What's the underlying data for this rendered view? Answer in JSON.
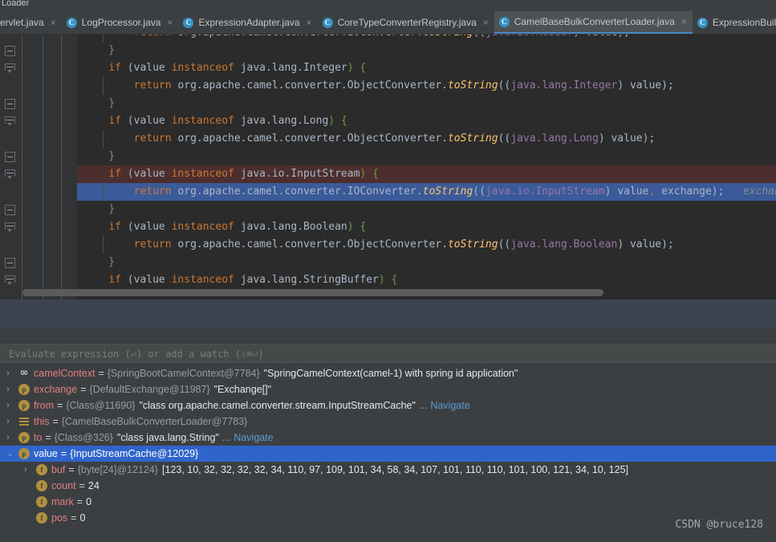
{
  "window": {
    "title_fragment": "Loader"
  },
  "tabs": [
    {
      "label": "ervlet.java",
      "icon": "java-class-icon",
      "active": false,
      "cut": true,
      "close": "×"
    },
    {
      "label": "LogProcessor.java",
      "icon": "java-class-icon",
      "active": false,
      "cut": false,
      "close": "×"
    },
    {
      "label": "ExpressionAdapter.java",
      "icon": "java-class-icon",
      "active": false,
      "cut": false,
      "close": "×"
    },
    {
      "label": "CoreTypeConverterRegistry.java",
      "icon": "java-class-icon",
      "active": false,
      "cut": false,
      "close": "×"
    },
    {
      "label": "CamelBaseBulkConverterLoader.java",
      "icon": "java-class-icon",
      "active": true,
      "cut": false,
      "close": "×"
    },
    {
      "label": "ExpressionBuild",
      "icon": "java-class-icon",
      "active": false,
      "cut": false,
      "close": ""
    }
  ],
  "editor": {
    "lines": [
      {
        "state": "partial",
        "indent_guide": true,
        "tokens": [
          {
            "t": "        ",
            "c": "pun"
          },
          {
            "t": "return",
            "c": "kw"
          },
          {
            "t": " org.apache.camel.converter.IOConverter.",
            "c": "typ"
          },
          {
            "t": "toString",
            "c": "mth"
          },
          {
            "t": "((",
            "c": "pun"
          },
          {
            "t": "java.io.Reader",
            "c": "cast"
          },
          {
            "t": ") value);",
            "c": "pun"
          }
        ]
      },
      {
        "state": "normal",
        "fold": "collapse",
        "indent_guide": false,
        "tokens": [
          {
            "t": "    }",
            "c": "br1"
          }
        ]
      },
      {
        "state": "normal",
        "fold": "tri",
        "indent_guide": false,
        "tokens": [
          {
            "t": "    ",
            "c": "pun"
          },
          {
            "t": "if",
            "c": "kw"
          },
          {
            "t": " (value ",
            "c": "pun"
          },
          {
            "t": "instanceof",
            "c": "kw"
          },
          {
            "t": " java.lang.Integer",
            "c": "typ"
          },
          {
            "t": ") ",
            "c": "par"
          },
          {
            "t": "{",
            "c": "par"
          }
        ]
      },
      {
        "state": "normal",
        "indent_guide": true,
        "tokens": [
          {
            "t": "        ",
            "c": "pun"
          },
          {
            "t": "return",
            "c": "kw"
          },
          {
            "t": " org.apache.camel.converter.ObjectConverter.",
            "c": "typ"
          },
          {
            "t": "toString",
            "c": "mth"
          },
          {
            "t": "((",
            "c": "pun"
          },
          {
            "t": "java.lang.Integer",
            "c": "cast"
          },
          {
            "t": ") value);",
            "c": "pun"
          }
        ]
      },
      {
        "state": "normal",
        "fold": "collapse",
        "indent_guide": false,
        "tokens": [
          {
            "t": "    }",
            "c": "br1"
          }
        ]
      },
      {
        "state": "normal",
        "fold": "tri",
        "indent_guide": false,
        "tokens": [
          {
            "t": "    ",
            "c": "pun"
          },
          {
            "t": "if",
            "c": "kw"
          },
          {
            "t": " (value ",
            "c": "pun"
          },
          {
            "t": "instanceof",
            "c": "kw"
          },
          {
            "t": " java.lang.Long",
            "c": "typ"
          },
          {
            "t": ") ",
            "c": "par"
          },
          {
            "t": "{",
            "c": "par"
          }
        ]
      },
      {
        "state": "normal",
        "indent_guide": true,
        "tokens": [
          {
            "t": "        ",
            "c": "pun"
          },
          {
            "t": "return",
            "c": "kw"
          },
          {
            "t": " org.apache.camel.converter.ObjectConverter.",
            "c": "typ"
          },
          {
            "t": "toString",
            "c": "mth"
          },
          {
            "t": "((",
            "c": "pun"
          },
          {
            "t": "java.lang.Long",
            "c": "cast"
          },
          {
            "t": ") value);",
            "c": "pun"
          }
        ]
      },
      {
        "state": "normal",
        "fold": "collapse",
        "indent_guide": false,
        "tokens": [
          {
            "t": "    }",
            "c": "br1"
          }
        ]
      },
      {
        "state": "breakpoint",
        "fold": "tri",
        "indent_guide": false,
        "tokens": [
          {
            "t": "    ",
            "c": "pun"
          },
          {
            "t": "if",
            "c": "kw"
          },
          {
            "t": " (value ",
            "c": "pun"
          },
          {
            "t": "instanceof",
            "c": "kw"
          },
          {
            "t": " java.io.InputStream",
            "c": "typ"
          },
          {
            "t": ") ",
            "c": "par"
          },
          {
            "t": "{",
            "c": "par"
          }
        ]
      },
      {
        "state": "executing",
        "indent_guide": true,
        "tokens": [
          {
            "t": "        ",
            "c": "pun"
          },
          {
            "t": "return",
            "c": "kw"
          },
          {
            "t": " org.apache.camel.converter.IOConverter.",
            "c": "typ"
          },
          {
            "t": "toString",
            "c": "mth"
          },
          {
            "t": "((",
            "c": "pun"
          },
          {
            "t": "java.io.InputStream",
            "c": "cast"
          },
          {
            "t": ") value",
            "c": "pun"
          },
          {
            "t": ",",
            "c": "kw"
          },
          {
            "t": " exchange);",
            "c": "pun"
          },
          {
            "t": "   exchange:",
            "c": "hint"
          }
        ]
      },
      {
        "state": "normal",
        "fold": "collapse",
        "indent_guide": false,
        "tokens": [
          {
            "t": "    }",
            "c": "br1"
          }
        ]
      },
      {
        "state": "normal",
        "fold": "tri",
        "indent_guide": false,
        "tokens": [
          {
            "t": "    ",
            "c": "pun"
          },
          {
            "t": "if",
            "c": "kw"
          },
          {
            "t": " (value ",
            "c": "pun"
          },
          {
            "t": "instanceof",
            "c": "kw"
          },
          {
            "t": " java.lang.Boolean",
            "c": "typ"
          },
          {
            "t": ") ",
            "c": "par"
          },
          {
            "t": "{",
            "c": "par"
          }
        ]
      },
      {
        "state": "normal",
        "indent_guide": true,
        "tokens": [
          {
            "t": "        ",
            "c": "pun"
          },
          {
            "t": "return",
            "c": "kw"
          },
          {
            "t": " org.apache.camel.converter.ObjectConverter.",
            "c": "typ"
          },
          {
            "t": "toString",
            "c": "mth"
          },
          {
            "t": "((",
            "c": "pun"
          },
          {
            "t": "java.lang.Boolean",
            "c": "cast"
          },
          {
            "t": ") value);",
            "c": "pun"
          }
        ]
      },
      {
        "state": "normal",
        "fold": "collapse",
        "indent_guide": false,
        "tokens": [
          {
            "t": "    }",
            "c": "br1"
          }
        ]
      },
      {
        "state": "normal",
        "fold": "tri",
        "indent_guide": false,
        "tokens": [
          {
            "t": "    ",
            "c": "pun"
          },
          {
            "t": "if",
            "c": "kw"
          },
          {
            "t": " (value ",
            "c": "pun"
          },
          {
            "t": "instanceof",
            "c": "kw"
          },
          {
            "t": " java.lang.StringBuffer",
            "c": "typ"
          },
          {
            "t": ") ",
            "c": "par"
          },
          {
            "t": "{",
            "c": "par"
          }
        ]
      }
    ]
  },
  "debugger": {
    "evaluate_placeholder": "Evaluate expression (⏎) or add a watch (⇧⌘⏎)",
    "variables": [
      {
        "twisty": "›",
        "icon": "watch-icon",
        "icon_glyph": "∞",
        "name": "camelContext",
        "eq": "=",
        "type": "{SpringBootCamelContext@7784}",
        "value": "\"SpringCamelContext(camel-1) with spring id application\"",
        "navigate": "",
        "ellipsis": "",
        "selected": false,
        "indent": 0
      },
      {
        "twisty": "›",
        "icon": "parameter-icon",
        "icon_glyph": "p",
        "name": "exchange",
        "eq": "=",
        "type": "{DefaultExchange@11987}",
        "value": "\"Exchange[]\"",
        "navigate": "",
        "ellipsis": "",
        "selected": false,
        "indent": 0
      },
      {
        "twisty": "›",
        "icon": "parameter-icon",
        "icon_glyph": "p",
        "name": "from",
        "eq": "=",
        "type": "{Class@11690}",
        "value": "\"class org.apache.camel.converter.stream.InputStreamCache\"",
        "navigate": "Navigate",
        "ellipsis": "...",
        "selected": false,
        "indent": 0
      },
      {
        "twisty": "›",
        "icon": "this-icon",
        "icon_glyph": "",
        "name": "this",
        "eq": "=",
        "type": "{CamelBaseBulkConverterLoader@7783}",
        "value": "",
        "navigate": "",
        "ellipsis": "",
        "selected": false,
        "indent": 0
      },
      {
        "twisty": "›",
        "icon": "parameter-icon",
        "icon_glyph": "p",
        "name": "to",
        "eq": "=",
        "type": "{Class@326}",
        "value": "\"class java.lang.String\"",
        "navigate": "Navigate",
        "ellipsis": "...",
        "selected": false,
        "indent": 0
      },
      {
        "twisty": "⌄",
        "icon": "parameter-icon",
        "icon_glyph": "p",
        "name": "value",
        "eq": "=",
        "type": "{InputStreamCache@12029}",
        "value": "",
        "navigate": "",
        "ellipsis": "",
        "selected": true,
        "indent": 0
      },
      {
        "twisty": "›",
        "icon": "field-icon",
        "icon_glyph": "f",
        "name": "buf",
        "eq": "=",
        "type": "{byte[24]@12124}",
        "value": "[123, 10, 32, 32, 32, 32, 34, 110, 97, 109, 101, 34, 58, 34, 107, 101, 110, 110, 101, 100, 121, 34, 10, 125]",
        "navigate": "",
        "ellipsis": "",
        "selected": false,
        "indent": 1
      },
      {
        "twisty": "",
        "icon": "field-icon",
        "icon_glyph": "f",
        "name": "count",
        "eq": "=",
        "type": "",
        "value": "24",
        "navigate": "",
        "ellipsis": "",
        "selected": false,
        "indent": 1
      },
      {
        "twisty": "",
        "icon": "field-icon",
        "icon_glyph": "f",
        "name": "mark",
        "eq": "=",
        "type": "",
        "value": "0",
        "navigate": "",
        "ellipsis": "",
        "selected": false,
        "indent": 1
      },
      {
        "twisty": "",
        "icon": "field-icon",
        "icon_glyph": "f",
        "name": "pos",
        "eq": "=",
        "type": "",
        "value": "0",
        "navigate": "",
        "ellipsis": "",
        "selected": false,
        "indent": 1
      }
    ]
  },
  "watermark": "CSDN @bruce128",
  "colors": {
    "editor_bg": "#2b2b2b",
    "panel_bg": "#3c3f41",
    "gutter_bg": "#313335",
    "breakpoint_line": "#4d2e2e",
    "execution_line": "#3b5a99",
    "selection": "#2f65ca",
    "keyword": "#cc7832",
    "method": "#ffc66d",
    "text": "#a9b7c6",
    "var_name": "#e08080",
    "link": "#5c9bd6",
    "tab_accent": "#4a88c7"
  }
}
